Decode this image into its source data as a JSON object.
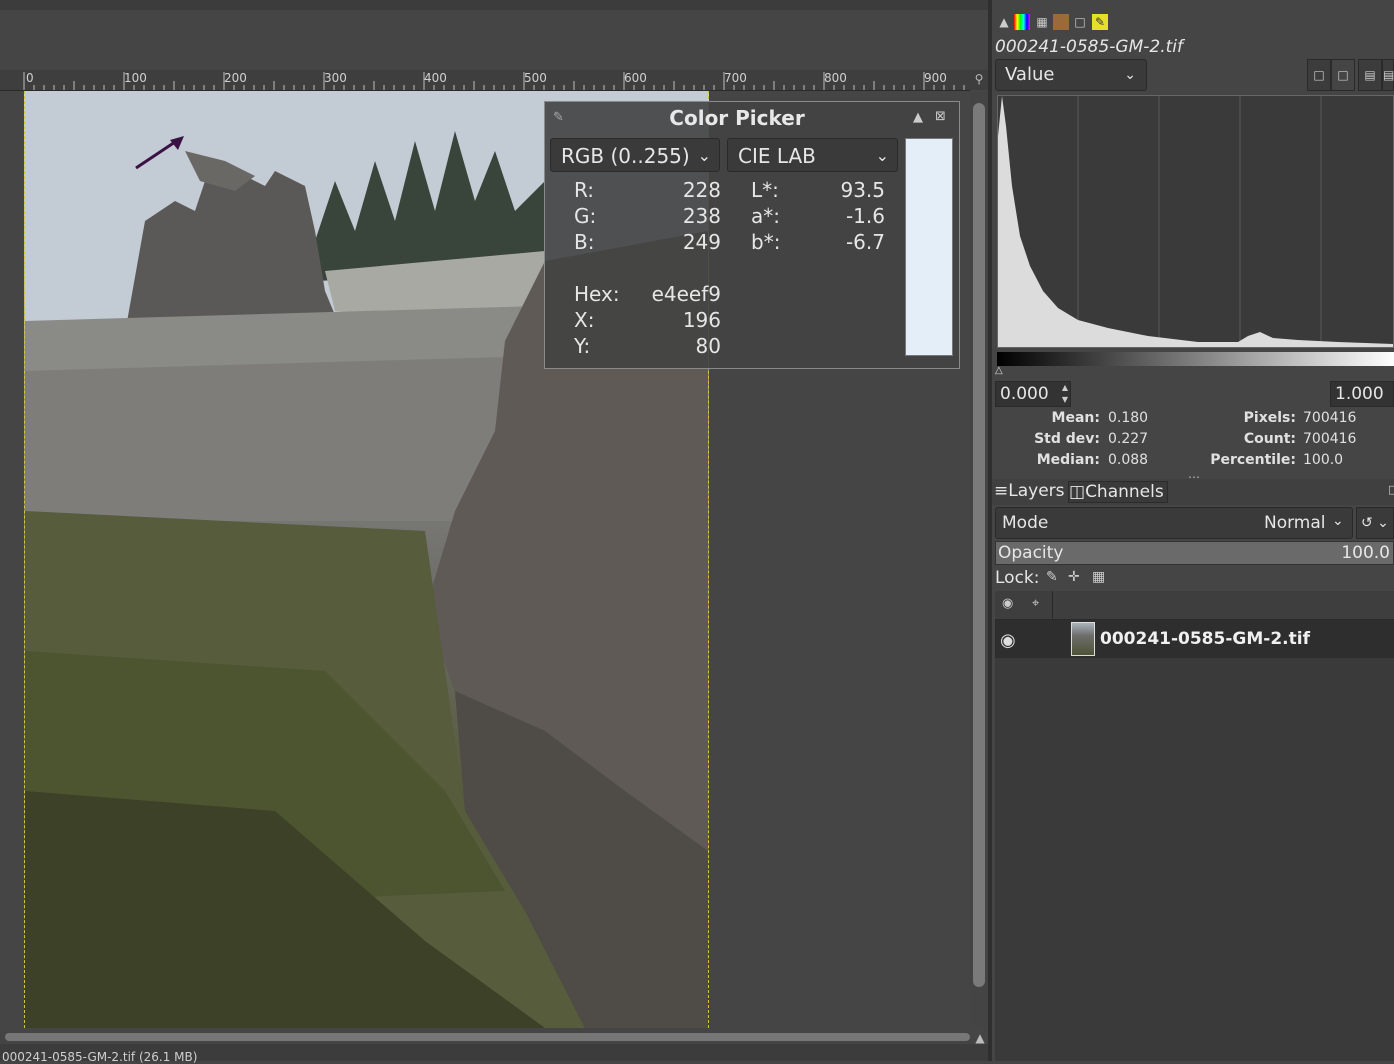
{
  "status": {
    "text": "000241-0585-GM-2.tif (26.1 MB)"
  },
  "ruler": {
    "labels": [
      "0",
      "100",
      "200",
      "300",
      "400",
      "500",
      "600",
      "700",
      "800",
      "900"
    ]
  },
  "color_picker": {
    "title": "Color Picker",
    "left_mode": "RGB (0..255)",
    "right_mode": "CIE LAB",
    "swatch_color": "#e4eef9",
    "rgb": [
      {
        "label": "R:",
        "value": "228"
      },
      {
        "label": "G:",
        "value": "238"
      },
      {
        "label": "B:",
        "value": "249"
      }
    ],
    "lab": [
      {
        "label": "L*:",
        "value": "93.5"
      },
      {
        "label": "a*:",
        "value": "-1.6"
      },
      {
        "label": "b*:",
        "value": "-6.7"
      }
    ],
    "hex": {
      "label": "Hex:",
      "value": "e4eef9"
    },
    "x": {
      "label": "X:",
      "value": "196"
    },
    "y": {
      "label": "Y:",
      "value": "80"
    }
  },
  "histogram": {
    "filename": "000241-0585-GM-2.tif",
    "channel": "Value",
    "range_low": "0.000",
    "range_high": "1.000",
    "stats": {
      "mean": {
        "label": "Mean:",
        "value": "0.180"
      },
      "std_dev": {
        "label": "Std dev:",
        "value": "0.227"
      },
      "median": {
        "label": "Median:",
        "value": "0.088"
      },
      "pixels": {
        "label": "Pixels:",
        "value": "700416"
      },
      "count": {
        "label": "Count:",
        "value": "700416"
      },
      "percentile": {
        "label": "Percentile:",
        "value": "100.0"
      }
    }
  },
  "layers": {
    "tab_layers": "Layers",
    "tab_channels": "Channels",
    "mode_label": "Mode",
    "mode_value": "Normal",
    "opacity_label": "Opacity",
    "opacity_value": "100.0",
    "lock_label": "Lock:",
    "layer_name": "000241-0585-GM-2.tif"
  },
  "colors": {
    "annotation_arrow": "#3b1244",
    "selection_border": "#d8c23a"
  }
}
